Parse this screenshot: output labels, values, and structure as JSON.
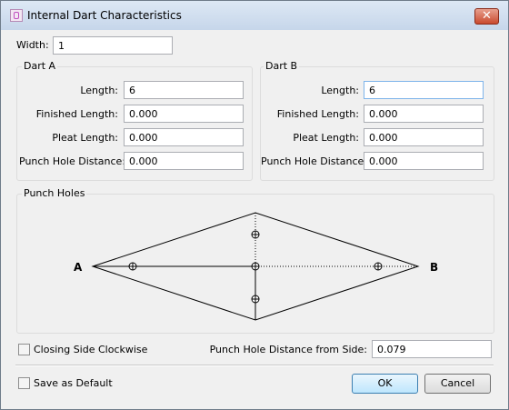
{
  "window": {
    "title": "Internal Dart Characteristics",
    "close_glyph": "✕"
  },
  "width": {
    "label": "Width:",
    "value": "1"
  },
  "dart_a": {
    "legend": "Dart A",
    "length": {
      "label": "Length:",
      "value": "6"
    },
    "finished_length": {
      "label": "Finished Length:",
      "value": "0.000"
    },
    "pleat_length": {
      "label": "Pleat Length:",
      "value": "0.000"
    },
    "punch_hole_distance": {
      "label": "Punch Hole Distance:",
      "value": "0.000"
    }
  },
  "dart_b": {
    "legend": "Dart B",
    "length": {
      "label": "Length:",
      "value": "6"
    },
    "finished_length": {
      "label": "Finished Length:",
      "value": "0.000"
    },
    "pleat_length": {
      "label": "Pleat Length:",
      "value": "0.000"
    },
    "punch_hole_distance": {
      "label": "Punch Hole Distance:",
      "value": "0.000"
    }
  },
  "punch_holes": {
    "legend": "Punch Holes",
    "point_a": "A",
    "point_b": "B"
  },
  "closing_side_clockwise": {
    "label": "Closing Side Clockwise",
    "checked": false
  },
  "punch_hole_distance_from_side": {
    "label": "Punch Hole Distance from Side:",
    "value": "0.079"
  },
  "save_as_default": {
    "label": "Save as Default",
    "checked": false
  },
  "buttons": {
    "ok": "OK",
    "cancel": "Cancel"
  },
  "icons": {
    "app": "dart-app-icon",
    "close": "close-icon",
    "hole": "punch-hole-icon"
  }
}
